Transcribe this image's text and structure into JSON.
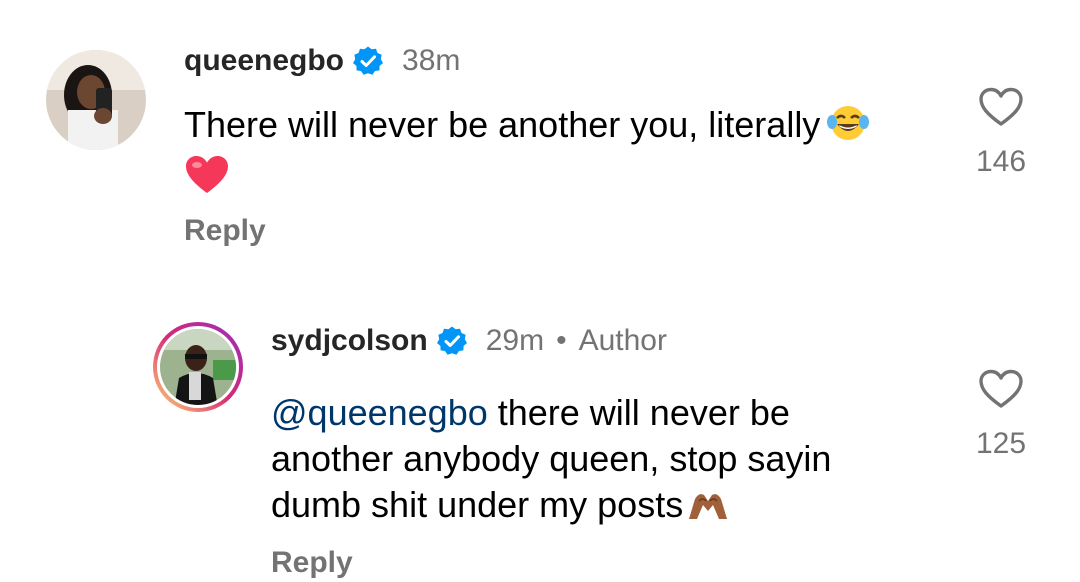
{
  "comments": [
    {
      "username": "queenegbo",
      "time": "38m",
      "text": "There will never be another you, literally",
      "likes": "146",
      "reply_label": "Reply",
      "emojis": [
        "face-with-tears-of-joy",
        "red-heart"
      ]
    },
    {
      "username": "sydjcolson",
      "time": "29m",
      "separator": "•",
      "badge": "Author",
      "mention": "@queenegbo",
      "text_line1": " there will never be",
      "text_line2": "another anybody queen, stop sayin",
      "text_line3": "dumb shit under my posts",
      "likes": "125",
      "reply_label": "Reply",
      "emojis": [
        "heart-hands"
      ]
    }
  ],
  "colors": {
    "verified": "#0095f6",
    "mention": "#00376b",
    "secondary_text": "#737373",
    "story_ring": [
      "#feda75",
      "#d62976",
      "#962fbf"
    ]
  },
  "icons": [
    "verified-badge-icon",
    "heart-outline-icon"
  ]
}
